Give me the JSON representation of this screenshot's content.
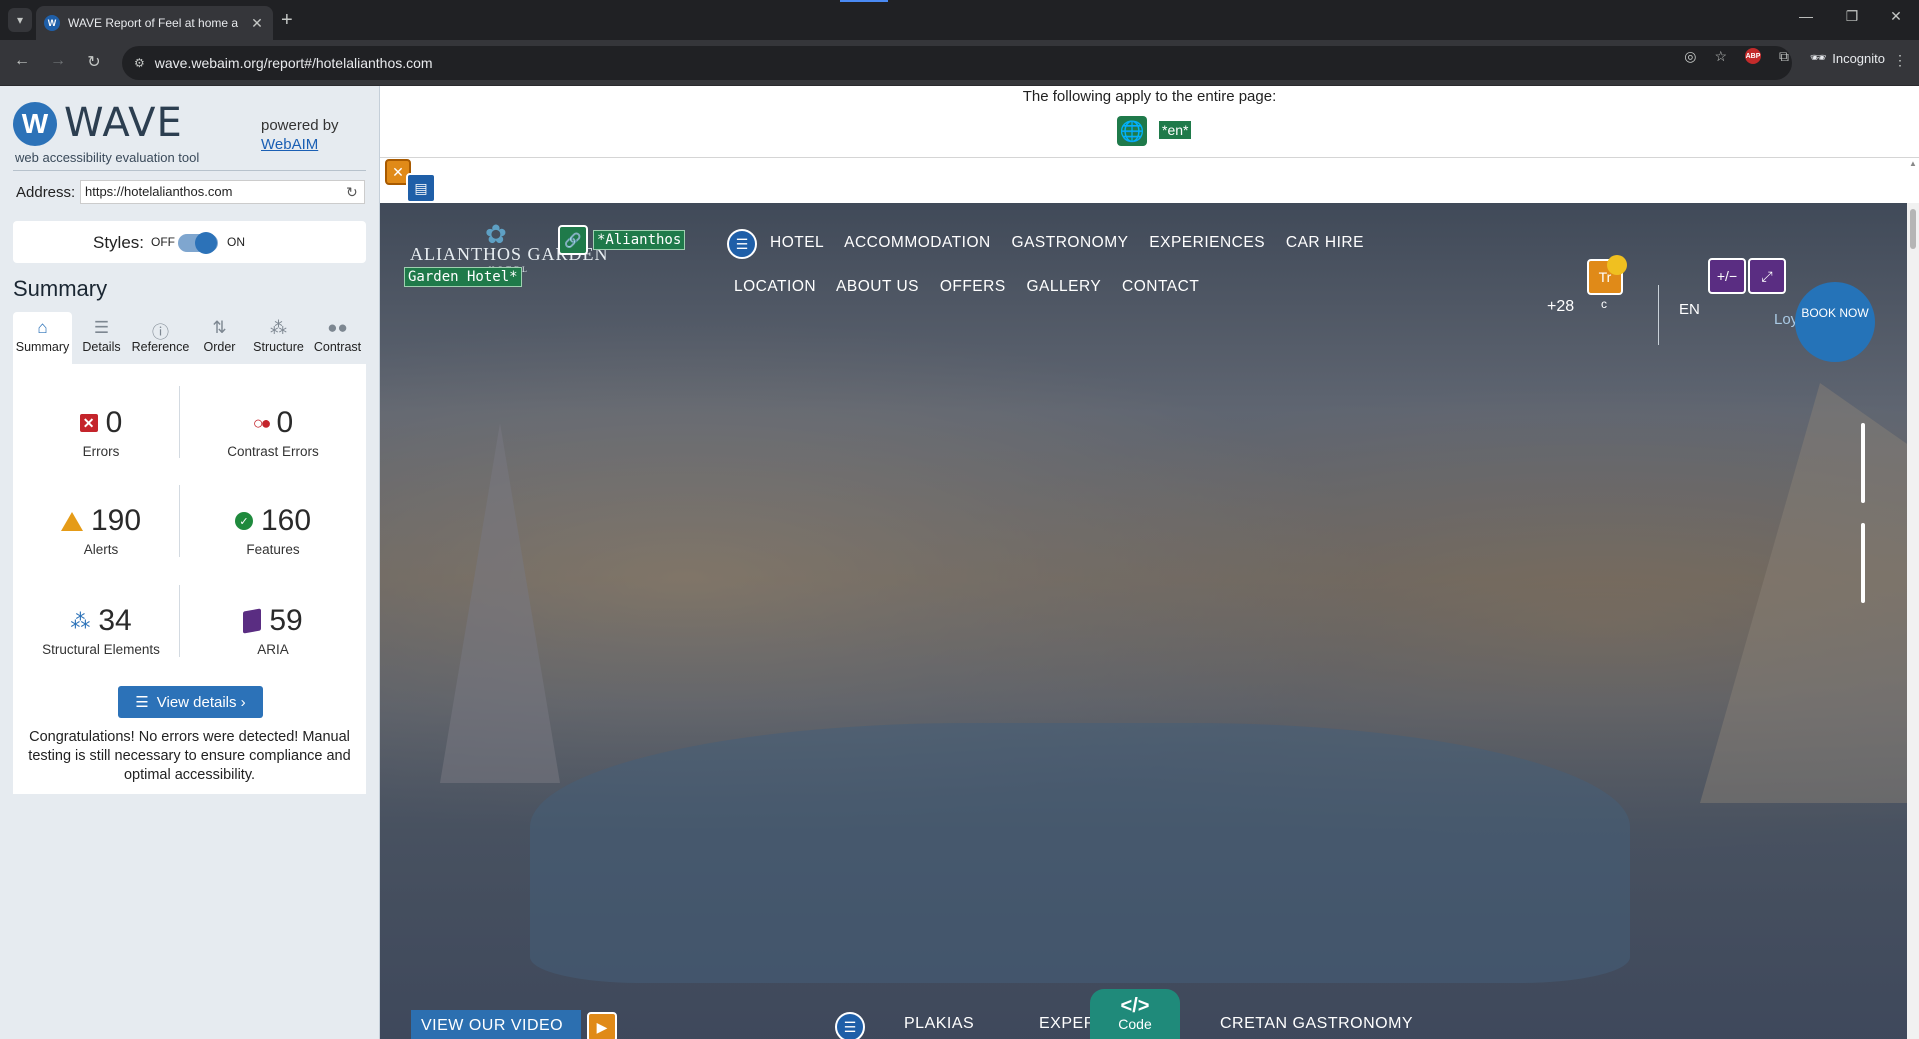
{
  "browser": {
    "tab_title": "WAVE Report of Feel at home a",
    "url": "wave.webaim.org/report#/hotelalianthos.com",
    "incognito_label": "Incognito",
    "abp_label": "ABP"
  },
  "wave": {
    "logo_letter": "W",
    "logo_text": "WAVE",
    "logo_subtitle": "web accessibility evaluation tool",
    "powered_by": "powered by",
    "webaim_link": "WebAIM",
    "address_label": "Address:",
    "address_value": "https://hotelalianthos.com",
    "styles_label": "Styles:",
    "styles_off": "OFF",
    "styles_on": "ON",
    "summary_title": "Summary",
    "tabs": [
      {
        "label": "Summary",
        "icon": "home-icon"
      },
      {
        "label": "Details",
        "icon": "list-icon"
      },
      {
        "label": "Reference",
        "icon": "info-icon"
      },
      {
        "label": "Order",
        "icon": "order-icon"
      },
      {
        "label": "Structure",
        "icon": "structure-icon"
      },
      {
        "label": "Contrast",
        "icon": "contrast-icon"
      }
    ],
    "stats": {
      "errors": {
        "value": "0",
        "label": "Errors"
      },
      "contrast_errors": {
        "value": "0",
        "label": "Contrast Errors"
      },
      "alerts": {
        "value": "190",
        "label": "Alerts"
      },
      "features": {
        "value": "160",
        "label": "Features"
      },
      "structural": {
        "value": "34",
        "label": "Structural Elements"
      },
      "aria": {
        "value": "59",
        "label": "ARIA"
      }
    },
    "view_details": "View details ›",
    "congrats": "Congratulations! No errors were detected! Manual testing is still necessary to ensure compliance and optimal accessibility."
  },
  "page": {
    "apply_text": "The following apply to the entire page:",
    "lang_tag": "*en*",
    "logo_name": "ALIANTHOS GARDEN",
    "logo_small": "HOTEL",
    "alt_tag_1": "*Alianthos",
    "alt_tag_2": "Garden Hotel*",
    "nav_row1": [
      "HOTEL",
      "ACCOMMODATION",
      "GASTRONOMY",
      "EXPERIENCES",
      "CAR HIRE"
    ],
    "nav_row2": [
      "LOCATION",
      "ABOUT US",
      "OFFERS",
      "GALLERY",
      "CONTACT"
    ],
    "plus28": "+28",
    "c_label": "c",
    "lang": "EN",
    "book_now": "BOOK NOW",
    "loyalty": "Loyalty Club",
    "video_btn": "VIEW OUR VIDEO",
    "bottom_nav": [
      "PLAKIAS",
      "EXPER",
      "CRETAN GASTRONOMY"
    ],
    "code_label": "Code",
    "code_symbol": "</>"
  }
}
